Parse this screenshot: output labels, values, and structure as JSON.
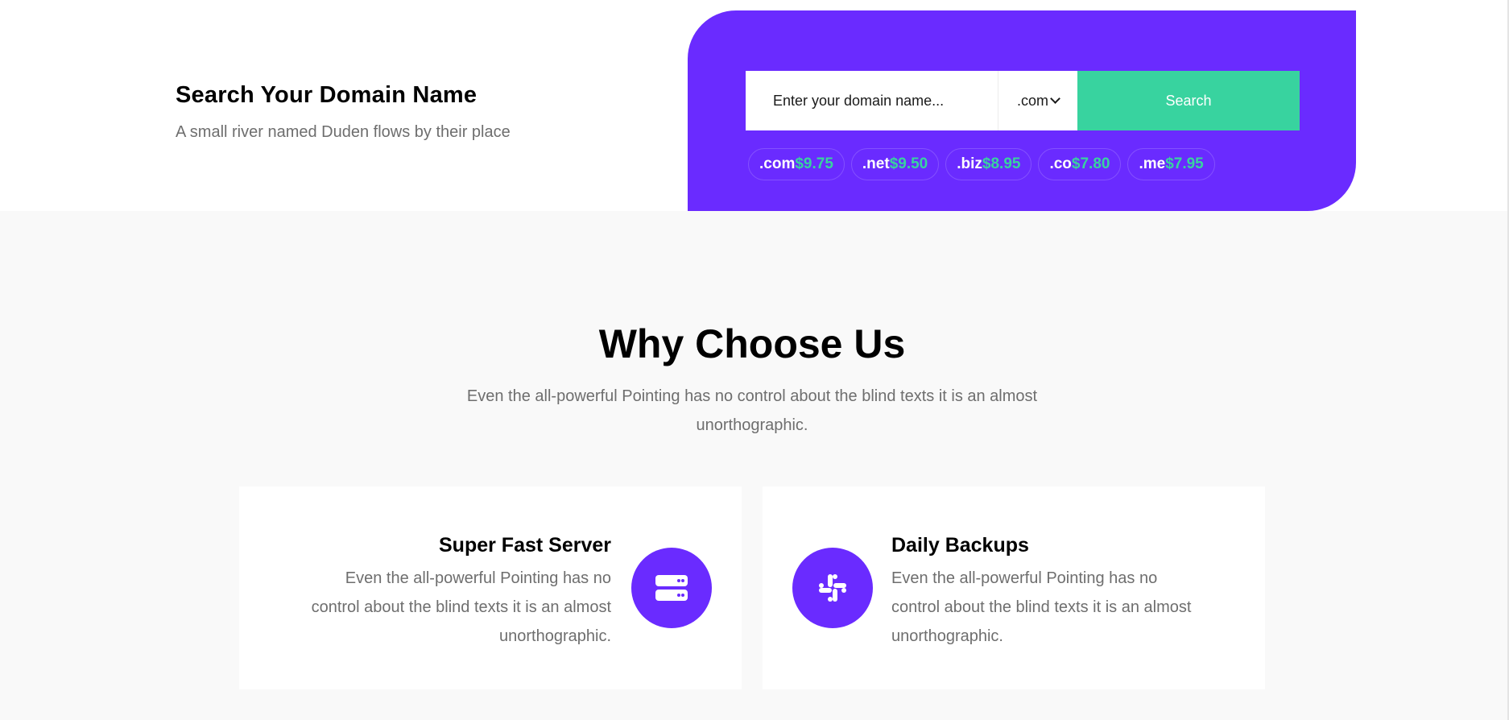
{
  "domain_search": {
    "heading": "Search Your Domain Name",
    "subtitle": "A small river named Duden flows by their place",
    "input_placeholder": "Enter your domain name...",
    "tld_selected": ".com",
    "search_label": "Search",
    "tld_prices": [
      {
        "tld": ".com",
        "price": "$9.75"
      },
      {
        "tld": ".net",
        "price": "$9.50"
      },
      {
        "tld": ".biz",
        "price": "$8.95"
      },
      {
        "tld": ".co",
        "price": "$7.80"
      },
      {
        "tld": ".me",
        "price": "$7.95"
      }
    ]
  },
  "why_choose": {
    "title": "Why Choose Us",
    "subtitle": "Even the all-powerful Pointing has no control about the blind texts it is an almost unorthographic.",
    "features": [
      {
        "title": "Super Fast Server",
        "description": "Even the all-powerful Pointing has no control about the blind texts it is an almost unorthographic.",
        "icon": "server-icon"
      },
      {
        "title": "Daily Backups",
        "description": "Even the all-powerful Pointing has no control about the blind texts it is an almost unorthographic.",
        "icon": "slack-icon"
      }
    ]
  },
  "colors": {
    "accent": "#6a2bff",
    "green": "#38d39f",
    "muted_text": "#6e6e6e",
    "section_bg": "#f9f9f9"
  }
}
